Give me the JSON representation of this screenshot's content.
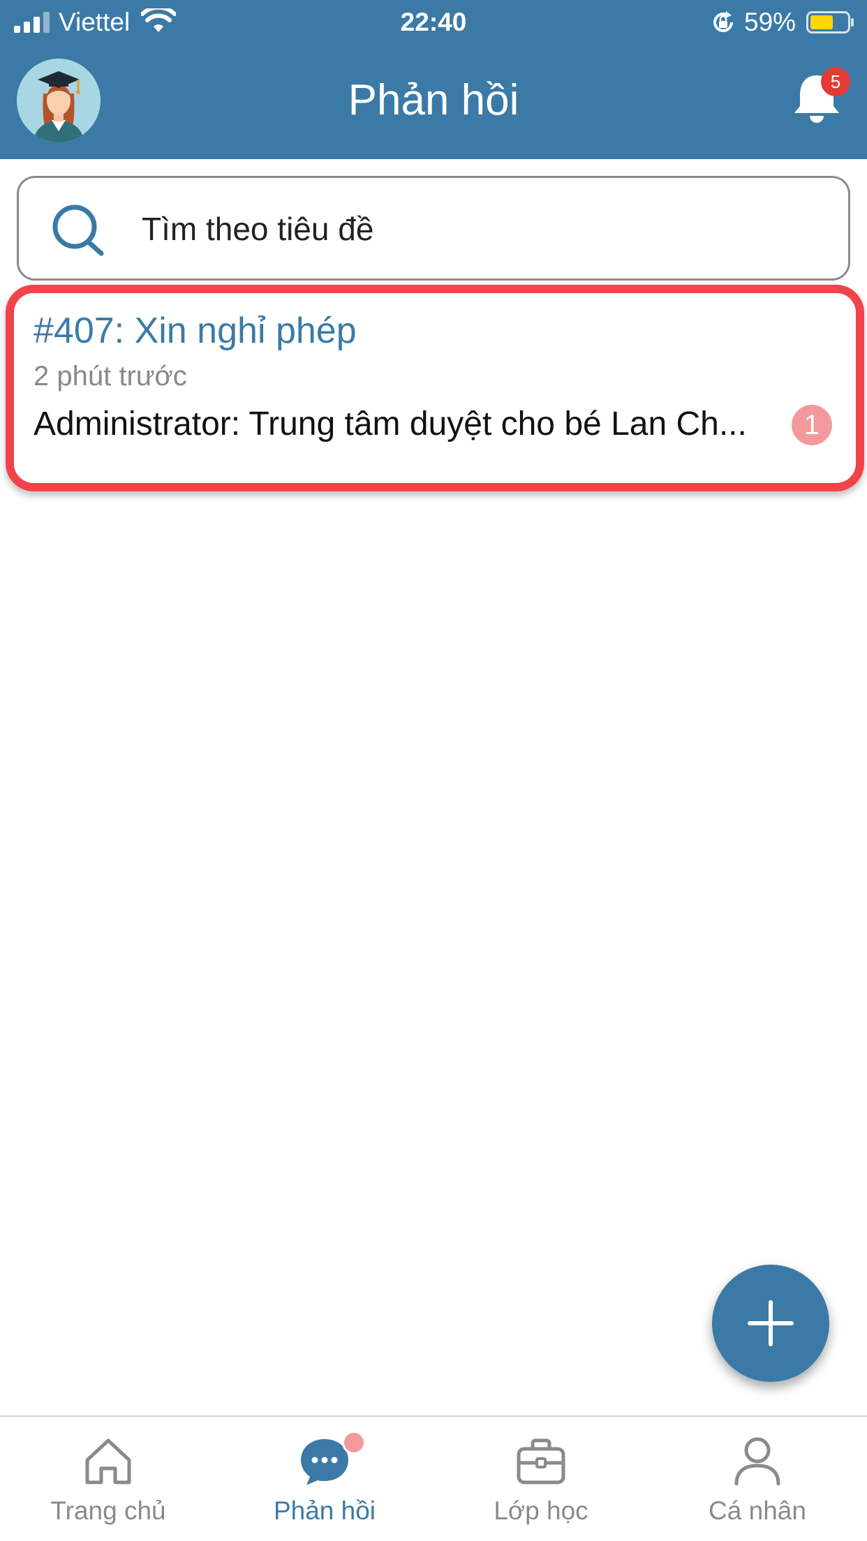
{
  "status_bar": {
    "carrier": "Viettel",
    "time": "22:40",
    "battery_percent": "59%"
  },
  "header": {
    "title": "Phản hồi",
    "notification_count": "5"
  },
  "search": {
    "placeholder": "Tìm theo tiêu đề",
    "value": ""
  },
  "feedback_list": [
    {
      "title": "#407: Xin nghỉ phép",
      "time_ago": "2 phút trước",
      "last_message": "Administrator: Trung tâm duyệt cho bé Lan Ch...",
      "unread_count": "1"
    }
  ],
  "tabs": [
    {
      "label": "Trang chủ",
      "icon": "home-icon",
      "active": false
    },
    {
      "label": "Phản hồi",
      "icon": "chat-bubble-icon",
      "active": true
    },
    {
      "label": "Lớp học",
      "icon": "briefcase-icon",
      "active": false
    },
    {
      "label": "Cá nhân",
      "icon": "user-icon",
      "active": false
    }
  ],
  "colors": {
    "primary": "#3b7aa6",
    "highlight": "#f2424a",
    "badge_red": "#e53935",
    "badge_pink": "#f29a9b",
    "tab_inactive": "#8a8a8a"
  }
}
